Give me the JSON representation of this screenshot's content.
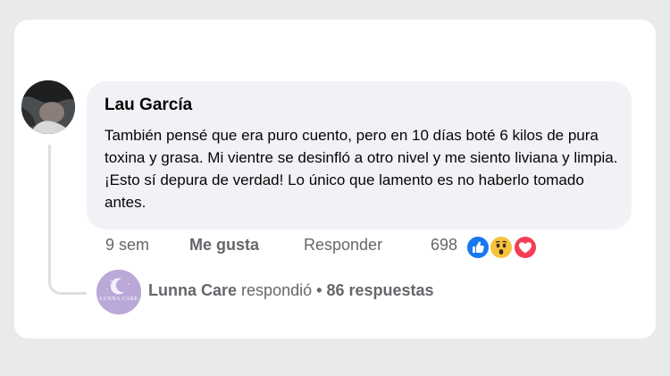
{
  "comment": {
    "author": "Lau García",
    "text": "También pensé que era puro cuento, pero en 10 días boté 6 kilos de pura toxina y grasa. Mi vientre se desinfló a otro nivel y me siento liviana y limpia. ¡Esto sí depura de verdad! Lo único que lamento es no haberlo tomado antes."
  },
  "actions": {
    "time": "9 sem",
    "like_label": "Me gusta",
    "reply_label": "Responder",
    "reaction_count": "698",
    "reactions": [
      "like-icon",
      "wow-icon",
      "love-icon"
    ]
  },
  "reply_summary": {
    "page_name": "Lunna Care",
    "verb": "respondió",
    "separator": "•",
    "count": "86 respuestas",
    "avatar_logo_text": "LUNNA CARE"
  },
  "colors": {
    "text_primary": "#050505",
    "text_secondary": "#65676b",
    "bubble_bg": "#f0f2f5",
    "like_blue": "#1877f2",
    "love_red": "#f33e58",
    "wow_yellow": "#f7c23d",
    "avatar_purple": "#b9a8d8"
  }
}
